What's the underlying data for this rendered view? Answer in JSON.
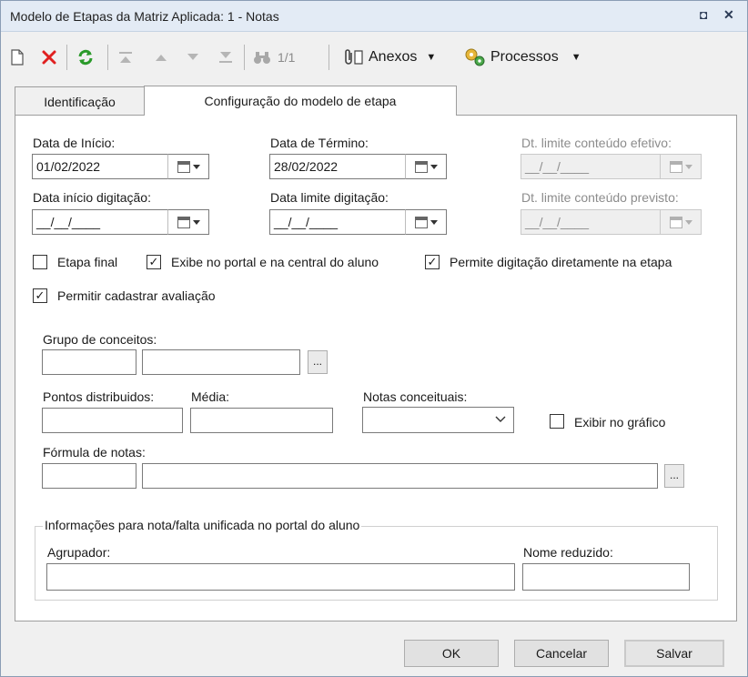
{
  "window": {
    "title": "Modelo de Etapas da Matriz Aplicada: 1 - Notas",
    "restore_glyph": "◘",
    "close_glyph": "✕"
  },
  "toolbar": {
    "record_counter": "1/1",
    "attachments_label": "Anexos",
    "processes_label": "Processos"
  },
  "tabs": [
    {
      "label": "Identificação",
      "active": false
    },
    {
      "label": "Configuração do modelo de etapa",
      "active": true
    }
  ],
  "dates": {
    "start_label": "Data de Início:",
    "start_value": "01/02/2022",
    "end_label": "Data de Término:",
    "end_value": "28/02/2022",
    "effective_limit_label": "Dt. limite conteúdo efetivo:",
    "effective_limit_value": "__/__/____",
    "typing_start_label": "Data início digitação:",
    "typing_start_value": "__/__/____",
    "typing_limit_label": "Data limite digitação:",
    "typing_limit_value": "__/__/____",
    "planned_limit_label": "Dt. limite conteúdo previsto:",
    "planned_limit_value": "__/__/____"
  },
  "checkboxes": {
    "final_stage": {
      "label": "Etapa final",
      "checked": false,
      "mark": ""
    },
    "show_portal": {
      "label": "Exibe no portal e na central do aluno",
      "checked": true,
      "mark": "✓"
    },
    "allow_typing": {
      "label": "Permite digitação diretamente na etapa",
      "checked": true,
      "mark": "✓"
    },
    "allow_evaluation": {
      "label": "Permitir cadastrar avaliação",
      "checked": true,
      "mark": "✓"
    },
    "show_chart": {
      "label": "Exibir no gráfico",
      "checked": false,
      "mark": ""
    }
  },
  "concepts": {
    "group_label": "Grupo de conceitos:",
    "code_value": "",
    "name_value": "",
    "lookup_label": "..."
  },
  "grades": {
    "points_label": "Pontos distribuidos:",
    "points_value": "",
    "average_label": "Média:",
    "average_value": "",
    "concept_notes_label": "Notas conceituais:",
    "concept_notes_value": "",
    "formula_label": "Fórmula de notas:",
    "formula_code_value": "",
    "formula_value": "",
    "formula_lookup_label": "..."
  },
  "unified": {
    "group_title": "Informações para nota/falta unificada no portal do aluno",
    "grouper_label": "Agrupador:",
    "grouper_value": "",
    "short_name_label": "Nome reduzido:",
    "short_name_value": ""
  },
  "buttons": {
    "ok": "OK",
    "cancel": "Cancelar",
    "save": "Salvar"
  },
  "colors": {
    "delete_red": "#e02020",
    "refresh_green": "#2a9a2a",
    "titlebar": "#e3ebf5"
  }
}
